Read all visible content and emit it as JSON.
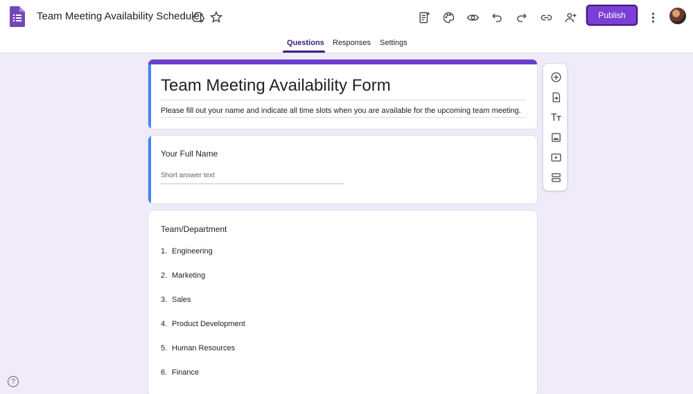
{
  "header": {
    "doc_title": "Team Meeting Availability Scheduler",
    "publish_label": "Publish",
    "icons": [
      "forms-app-icon",
      "drive-add-icon",
      "star-icon",
      "addons-icon",
      "palette-icon",
      "preview-icon",
      "undo-icon",
      "redo-icon",
      "link-icon",
      "add-collaborator-icon",
      "more-vert-icon"
    ],
    "accent": "#7b3fd6"
  },
  "tabs": [
    {
      "label": "Questions",
      "active": true
    },
    {
      "label": "Responses",
      "active": false
    },
    {
      "label": "Settings",
      "active": false
    }
  ],
  "form": {
    "title": "Team Meeting Availability Form",
    "description": "Please fill out your name and indicate all time slots when you are available for the upcoming team meeting."
  },
  "questions": [
    {
      "title": "Your Full Name",
      "placeholder": "Short answer text"
    },
    {
      "title": "Team/Department",
      "options": [
        {
          "num": "1.",
          "label": "Engineering"
        },
        {
          "num": "2.",
          "label": "Marketing"
        },
        {
          "num": "3.",
          "label": "Sales"
        },
        {
          "num": "4.",
          "label": "Product Development"
        },
        {
          "num": "5.",
          "label": "Human Resources"
        },
        {
          "num": "6.",
          "label": "Finance"
        }
      ]
    }
  ],
  "side_toolbar": [
    "add-question-icon",
    "import-questions-icon",
    "add-title-icon",
    "add-image-icon",
    "add-video-icon",
    "add-section-icon"
  ],
  "help_glyph": "?"
}
